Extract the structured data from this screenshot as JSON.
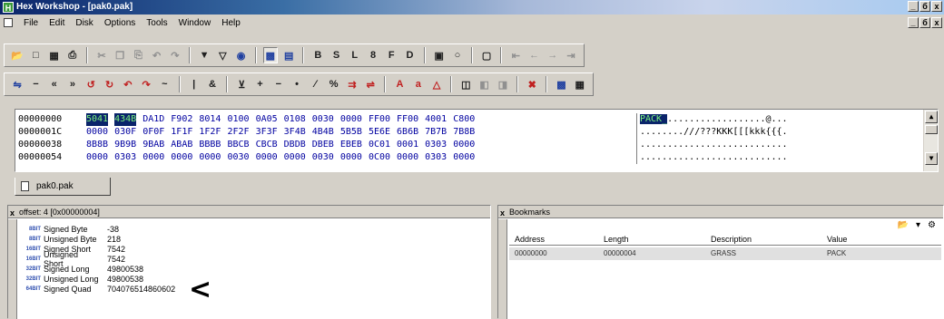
{
  "window": {
    "title": "Hex Workshop - [pak0.pak]",
    "controls_top": [
      "_",
      "б",
      "x"
    ],
    "controls_doc": [
      "_",
      "б",
      "x"
    ]
  },
  "menu": [
    "File",
    "Edit",
    "Disk",
    "Options",
    "Tools",
    "Window",
    "Help"
  ],
  "toolbar1": {
    "text_buttons": [
      "B",
      "S",
      "L",
      "8",
      "F",
      "D"
    ]
  },
  "hex": {
    "rows": [
      {
        "addr": "00000000",
        "bytes": [
          "5041",
          "434B",
          "DA1D",
          "F902",
          "8014",
          "0100",
          "0A05",
          "0108",
          "0030",
          "0000",
          "FF00",
          "FF00",
          "4001",
          "C800"
        ],
        "ascii_hl": "PACK_",
        "ascii": "..................@..."
      },
      {
        "addr": "0000001C",
        "bytes": [
          "0000",
          "030F",
          "0F0F",
          "1F1F",
          "1F2F",
          "2F2F",
          "3F3F",
          "3F4B",
          "4B4B",
          "5B5B",
          "5E6E",
          "6B6B",
          "7B7B",
          "7B8B"
        ],
        "ascii_hl": "",
        "ascii": "........///???KKK[[[kkk{{{."
      },
      {
        "addr": "00000038",
        "bytes": [
          "8B8B",
          "9B9B",
          "9BAB",
          "ABAB",
          "BBBB",
          "BBCB",
          "CBCB",
          "DBDB",
          "DBEB",
          "EBEB",
          "0C01",
          "0001",
          "0303",
          "0000"
        ],
        "ascii_hl": "",
        "ascii": "..........................."
      },
      {
        "addr": "00000054",
        "bytes": [
          "0000",
          "0303",
          "0000",
          "0000",
          "0000",
          "0030",
          "0000",
          "0000",
          "0030",
          "0000",
          "0C00",
          "0000",
          "0303",
          "0000"
        ],
        "ascii_hl": "",
        "ascii": "..........................."
      }
    ]
  },
  "tab": {
    "label": "pak0.pak"
  },
  "inspector": {
    "title": "offset: 4 [0x00000004]",
    "rows": [
      {
        "tag": "8BIT",
        "label": "Signed Byte",
        "value": "-38"
      },
      {
        "tag": "8BIT",
        "label": "Unsigned Byte",
        "value": "218"
      },
      {
        "tag": "16BIT",
        "label": "Signed Short",
        "value": "7542"
      },
      {
        "tag": "16BIT",
        "label": "Unsigned Short",
        "value": "7542"
      },
      {
        "tag": "32BIT",
        "label": "Signed Long",
        "value": "49800538"
      },
      {
        "tag": "32BIT",
        "label": "Unsigned Long",
        "value": "49800538"
      },
      {
        "tag": "64BIT",
        "label": "Signed Quad",
        "value": "704076514860602"
      }
    ],
    "pointer": "<"
  },
  "bookmarks": {
    "title": "Bookmarks",
    "columns": [
      "Address",
      "Length",
      "Description",
      "Value"
    ],
    "rows": [
      {
        "address": "00000000",
        "length": "00000004",
        "description": "GRASS",
        "value": "PACK"
      }
    ]
  },
  "colors": {
    "title_start": "#0a246a",
    "selection": "#0a246a",
    "hex_text": "#0000a0",
    "ascii_hl_text": "#7cf07c"
  }
}
